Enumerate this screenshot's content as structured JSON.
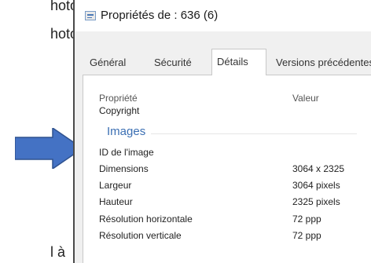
{
  "background_text": [
    "hotos",
    "hotos",
    "l à"
  ],
  "arrow": {
    "icon": "right-arrow-icon",
    "color": "#4472c4"
  },
  "dialog": {
    "title": "Propriétés de : 636 (6)",
    "tabs": [
      "Général",
      "Sécurité",
      "Détails",
      "Versions précédentes"
    ],
    "active_tab": "Détails",
    "columns": {
      "property": "Propriété",
      "value": "Valeur"
    },
    "rows_before": [
      {
        "name": "Copyright",
        "value": ""
      }
    ],
    "group": "Images",
    "rows": [
      {
        "name": "ID de l'image",
        "value": ""
      },
      {
        "name": "Dimensions",
        "value": "3064 x 2325"
      },
      {
        "name": "Largeur",
        "value": "3064 pixels"
      },
      {
        "name": "Hauteur",
        "value": "2325 pixels"
      },
      {
        "name": "Résolution horizontale",
        "value": "72 ppp"
      },
      {
        "name": "Résolution verticale",
        "value": "72 ppp"
      }
    ]
  }
}
